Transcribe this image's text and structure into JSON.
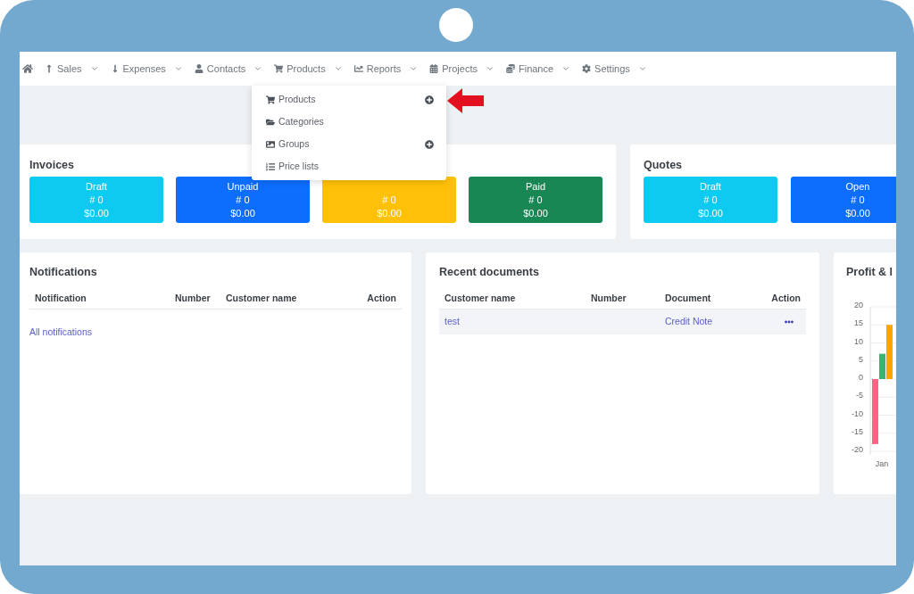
{
  "nav": {
    "items": [
      {
        "label": "Sales"
      },
      {
        "label": "Expenses"
      },
      {
        "label": "Contacts"
      },
      {
        "label": "Products"
      },
      {
        "label": "Reports"
      },
      {
        "label": "Projects"
      },
      {
        "label": "Finance"
      },
      {
        "label": "Settings"
      }
    ]
  },
  "dropdown": {
    "items": [
      {
        "label": "Products",
        "add_button": true
      },
      {
        "label": "Categories",
        "add_button": false
      },
      {
        "label": "Groups",
        "add_button": true
      },
      {
        "label": "Price lists",
        "add_button": false
      }
    ]
  },
  "invoices": {
    "title": "Invoices",
    "boxes": [
      {
        "label": "Draft",
        "count": "# 0",
        "amount": "$0.00",
        "color": "#0dcaf0"
      },
      {
        "label": "Unpaid",
        "count": "# 0",
        "amount": "$0.00",
        "color": "#0d6efd"
      },
      {
        "count": "# 0",
        "amount": "$0.00",
        "color": "#ffc107"
      },
      {
        "label": "Paid",
        "count": "# 0",
        "amount": "$0.00",
        "color": "#198754"
      }
    ]
  },
  "quotes": {
    "title": "Quotes",
    "boxes": [
      {
        "label": "Draft",
        "count": "# 0",
        "amount": "$0.00",
        "color": "#0dcaf0"
      },
      {
        "label": "Open",
        "count": "# 0",
        "amount": "$0.00",
        "color": "#0d6efd"
      }
    ]
  },
  "notifications": {
    "title": "Notifications",
    "columns": [
      "Notification",
      "Number",
      "Customer name",
      "Action"
    ],
    "link": "All notifications"
  },
  "recent_documents": {
    "title": "Recent documents",
    "columns": [
      "Customer name",
      "Number",
      "Document",
      "Action"
    ],
    "rows": [
      {
        "customer": "test",
        "document": "Credit Note"
      }
    ]
  },
  "profit_loss": {
    "title": "Profit & l",
    "chart_data": {
      "type": "bar",
      "grid": true,
      "categories": [
        "Jan"
      ],
      "ylim": [
        -20,
        20
      ],
      "yticks": [
        -20,
        -15,
        -10,
        -5,
        0,
        5,
        10,
        15,
        20
      ],
      "series": [
        {
          "color": "#ff6384",
          "values": [
            -18
          ]
        },
        {
          "color": "#3cb371",
          "values": [
            7
          ]
        },
        {
          "color": "#ffa500",
          "values": [
            15
          ]
        }
      ]
    }
  }
}
